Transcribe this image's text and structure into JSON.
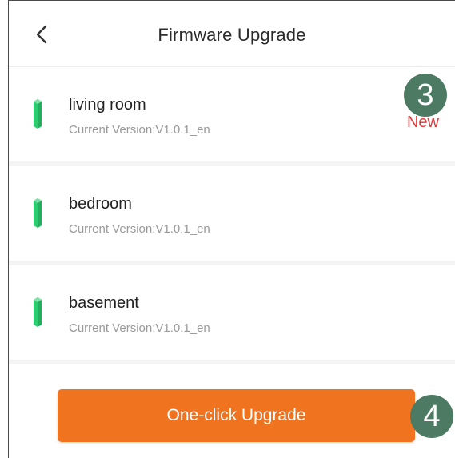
{
  "header": {
    "title": "Firmware Upgrade",
    "back_icon": "chevron-left-icon"
  },
  "devices": [
    {
      "name": "living room",
      "version": "Current Version:V1.0.1_en",
      "new_label": "New",
      "icon": "sensor-device-icon"
    },
    {
      "name": "bedroom",
      "version": "Current Version:V1.0.1_en",
      "icon": "sensor-device-icon"
    },
    {
      "name": "basement",
      "version": "Current Version:V1.0.1_en",
      "icon": "sensor-device-icon"
    }
  ],
  "annotations": {
    "badge_3": "3",
    "badge_4": "4"
  },
  "actions": {
    "upgrade_label": "One-click Upgrade"
  },
  "colors": {
    "accent": "#f0731f",
    "new_tag": "#e03a3a",
    "device_icon": "#2ecc71",
    "badge": "#4c7a62"
  }
}
